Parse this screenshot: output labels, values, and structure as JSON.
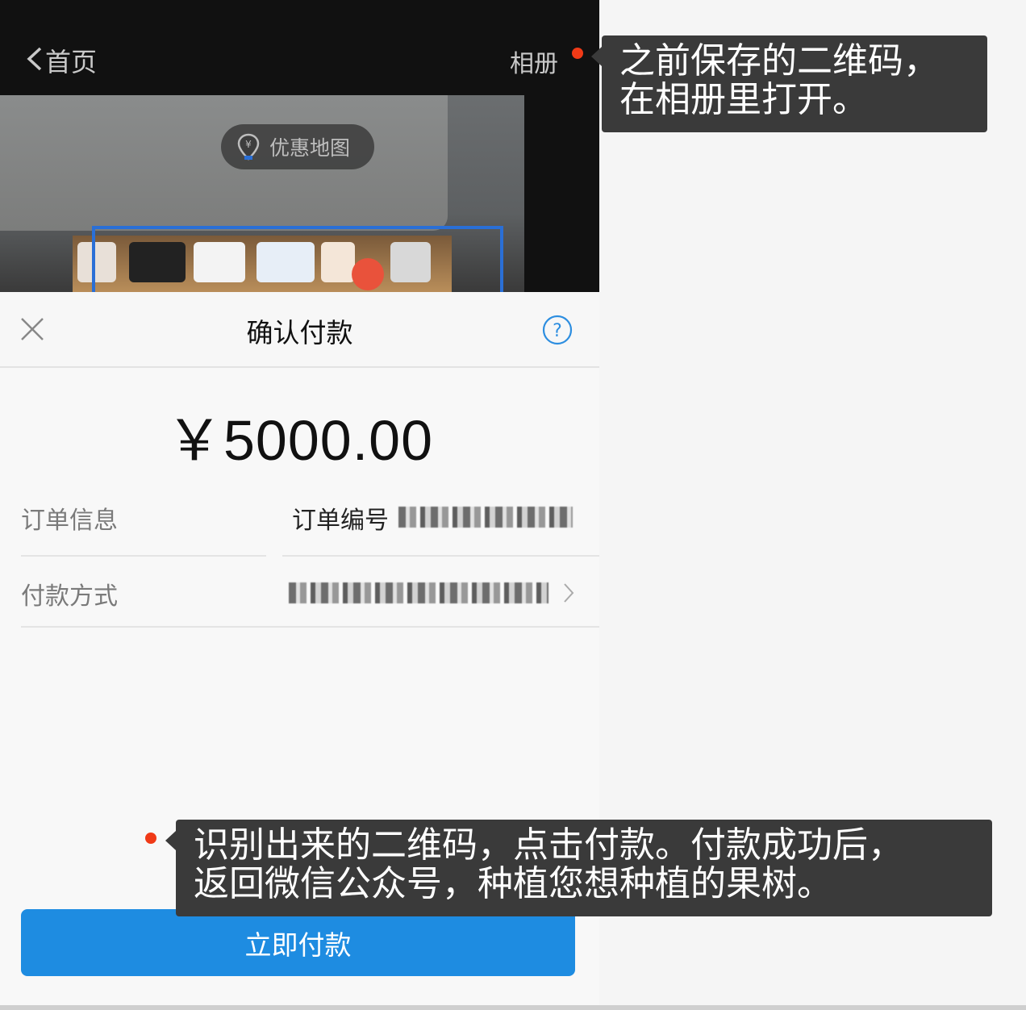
{
  "scanner": {
    "back_label": "首页",
    "album_label": "相册",
    "pill_label": "优惠地图"
  },
  "sheet": {
    "title": "确认付款",
    "amount": "￥5000.00",
    "order_label": "订单信息",
    "order_value_prefix": "订单编号",
    "method_label": "付款方式",
    "pay_button": "立即付款"
  },
  "callouts": {
    "top": [
      "之前保存的二维码，",
      "在相册里打开。"
    ],
    "bottom": [
      "识别出来的二维码，点击付款。付款成功后，",
      "返回微信公众号，种植您想种植的果树。"
    ]
  },
  "colors": {
    "accent": "#1e8ce1",
    "annotation_bg": "#3a3a3a",
    "marker": "#f03a17"
  }
}
